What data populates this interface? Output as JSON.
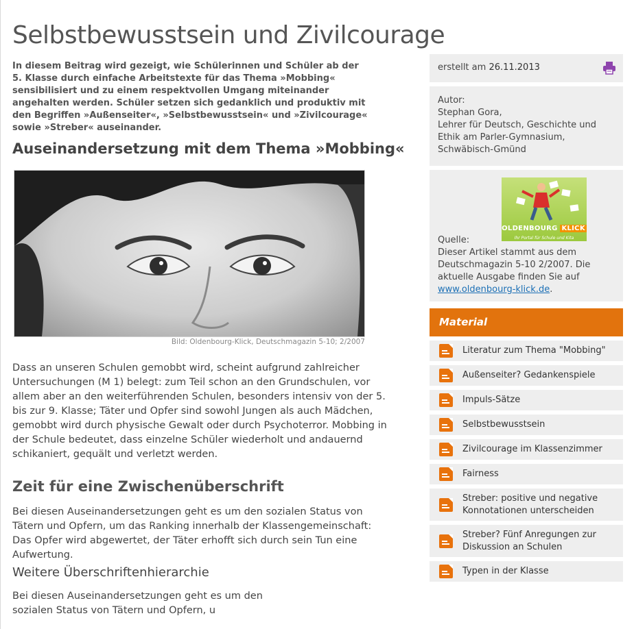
{
  "article": {
    "title": "Selbstbewusstsein und Zivilcourage",
    "lead": "In diesem Beitrag wird gezeigt, wie Schülerinnen und Schüler ab der 5. Klasse durch einfache Arbeitstexte für das Thema »Mobbing« sensibilisiert und zu einem respektvollen Umgang miteinander angehalten werden. Schüler setzen sich gedanklich und produktiv mit den Begriffen »Außenseiter«, »Selbstbewusstsein« und »Zivilcourage« sowie »Streber« auseinander.",
    "heading1": "Auseinandersetzung mit dem Thema »Mobbing«",
    "image_caption": "Bild: Oldenbourg-Klick, Deutschmagazin 5-10; 2/2007",
    "paragraph1": "Dass an unseren Schulen gemobbt wird, scheint aufgrund zahlreicher Untersuchungen (M 1) belegt: zum Teil schon an den Grundschulen, vor allem aber an den weiterführenden Schulen, besonders intensiv von der 5. bis zur 9. Klasse; Täter und Opfer sind sowohl Jungen als auch Mädchen, gemobbt wird durch physische Gewalt oder durch Psychoterror. Mobbing in der Schule bedeutet, dass einzelne Schüler wiederholt und andauernd schikaniert, gequält und verletzt werden.",
    "heading2": "Zeit für eine Zwischenüberschrift",
    "paragraph2": "Bei diesen Auseinandersetzungen geht es um den sozialen Status von Tätern und Opfern, um das Ranking innerhalb der Klassengemeinschaft: Das Opfer wird abgewertet, der Täter erhofft sich durch sein Tun eine Aufwertung.",
    "heading3": "Weitere Überschriftenhierarchie",
    "paragraph3": "Bei diesen Auseinandersetzungen geht es um den sozialen Status von Tätern und Opfern, u"
  },
  "sidebar": {
    "created_label": "erstellt am",
    "created_date": "26.11.2013",
    "print_icon": "printer-icon",
    "author_label": "Autor:",
    "author_lines": [
      "Stephan Gora,",
      "Lehrer für Deutsch, Geschichte und",
      "Ethik am Parler-Gymnasium,",
      "Schwäbisch-Gmünd"
    ],
    "logo_brand": "OLDENBOURG",
    "logo_brand_accent": "KLICK",
    "logo_tagline": "Ihr Portal für Schule und Kita",
    "source_label": "Quelle:",
    "source_text": "Dieser Artikel stammt aus dem Deutschmagazin 5-10 2/2007. Die aktuelle Ausgabe finden Sie auf",
    "source_link": "www.oldenbourg-klick.de",
    "source_tail": "."
  },
  "material": {
    "title": "Material",
    "accent_color": "#e2730d",
    "items": [
      "Literatur zum Thema \"Mobbing\"",
      "Außenseiter? Gedankenspiele",
      "Impuls-Sätze",
      "Selbstbewusstsein",
      "Zivilcourage im Klassenzimmer",
      "Fairness",
      "Streber: positive und negative Konnotationen unterscheiden",
      "Streber? Fünf Anregungen zur Diskussion an Schulen",
      "Typen in der Klasse"
    ]
  }
}
